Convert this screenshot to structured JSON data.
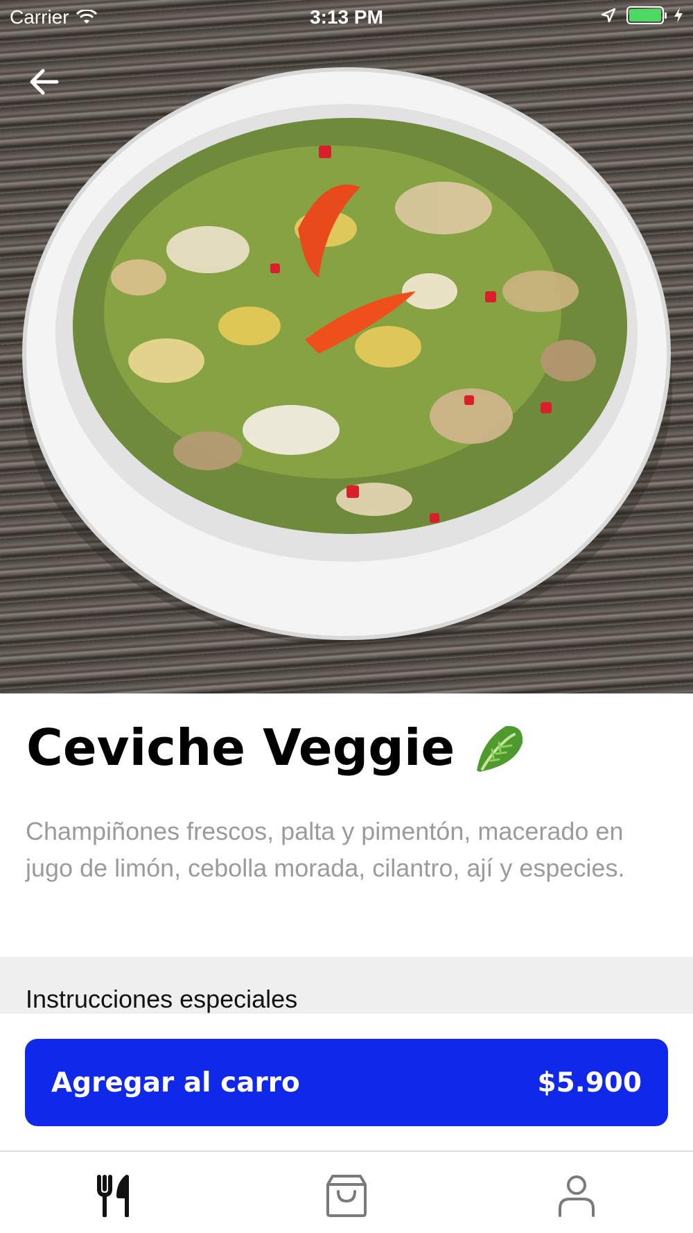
{
  "status_bar": {
    "carrier": "Carrier",
    "time": "3:13 PM",
    "battery_level": 1.0,
    "icons": [
      "wifi-icon",
      "location-arrow-icon",
      "battery-icon",
      "charging-bolt-icon"
    ]
  },
  "hero": {
    "back_icon": "arrow-left-icon"
  },
  "product": {
    "title": "Ceviche Veggie",
    "title_emoji": "🥬",
    "description": "Champiñones frescos, palta y pimentón, macerado en jugo de limón, cebolla morada, cilantro, ají y especies."
  },
  "special_instructions": {
    "label": "Instrucciones especiales"
  },
  "cart": {
    "button_label": "Agregar al carro",
    "price": "$5.900"
  },
  "tab_bar": {
    "items": [
      {
        "icon": "fork-knife-icon",
        "active": true
      },
      {
        "icon": "shopping-bag-icon",
        "active": false
      },
      {
        "icon": "user-icon",
        "active": false
      }
    ]
  },
  "colors": {
    "accent": "#0f28ea",
    "description_text": "#9b9b9b",
    "battery": "#4cd964",
    "tab_active": "#111111",
    "tab_inactive": "#7a7a7a"
  }
}
